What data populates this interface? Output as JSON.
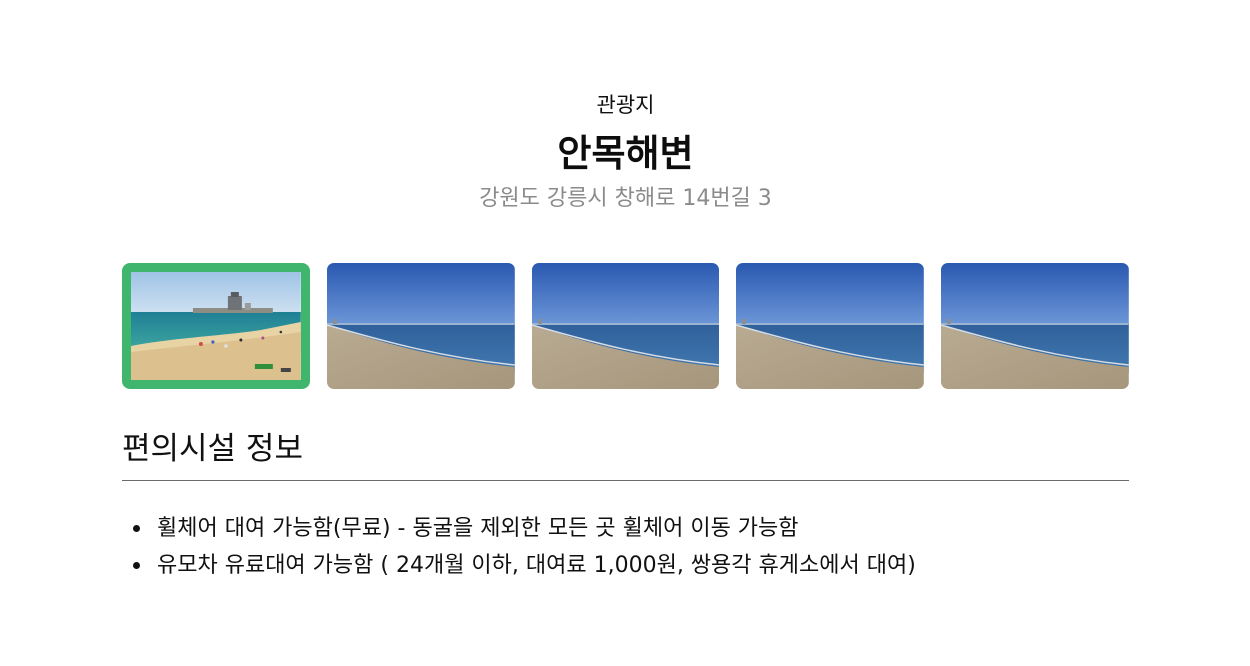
{
  "header": {
    "category": "관광지",
    "title": "안목해변",
    "address": "강원도 강릉시 창해로 14번길 3"
  },
  "gallery": {
    "images": [
      {
        "name": "beach-harbor-photo",
        "selected": true
      },
      {
        "name": "beach-shore-photo",
        "selected": false
      },
      {
        "name": "beach-shore-photo",
        "selected": false
      },
      {
        "name": "beach-shore-photo",
        "selected": false
      },
      {
        "name": "beach-shore-photo",
        "selected": false
      }
    ],
    "selected_border_color": "#3fb56d"
  },
  "facilities": {
    "title": "편의시설 정보",
    "items": [
      "휠체어 대여 가능함(무료) - 동굴을 제외한 모든 곳 휠체어 이동 가능함",
      "유모차 유료대여 가능함 ( 24개월 이하, 대여료 1,000원, 쌍용각 휴게소에서 대여)"
    ]
  }
}
